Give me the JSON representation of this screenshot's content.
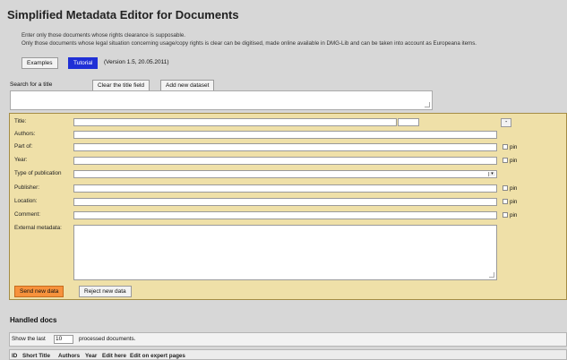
{
  "header": {
    "title": "Simplified Metadata Editor for Documents",
    "note1": "Enter only those documents whose rights clearance is supposable.",
    "note2": "Only those documents whose legal situation concerning usage/copy rights is clear can be digitised, made online available in DMG-Lib and can be taken into account as Europeana items."
  },
  "toolbar": {
    "examples": "Examples",
    "tutorial": "Tutorial",
    "version": "(Version 1.5, 20.05.2011)"
  },
  "search": {
    "label": "Search for a title",
    "clear": "Clear the title field",
    "add": "Add new dataset",
    "value": ""
  },
  "form": {
    "title": "Title:",
    "authors": "Authors:",
    "part_of": "Part of:",
    "year": "Year:",
    "type": "Type of publication",
    "publisher": "Publisher:",
    "location": "Location:",
    "comment": "Comment:",
    "external": "External metadata:",
    "pin": "pin",
    "send": "Send new data",
    "reject": "Reject new data",
    "expand": "-"
  },
  "handled": {
    "heading": "Handled docs",
    "show_prefix": "Show the last",
    "show_count": "10",
    "show_suffix": "processed documents.",
    "columns": [
      "ID",
      "Short Title",
      "Authors",
      "Year",
      "Edit here",
      "Edit on expert pages"
    ]
  },
  "colors": {
    "panel_bg": "#efe0a8",
    "tutorial_bg": "#1f2fd6",
    "send_bg": "#f7923c"
  }
}
